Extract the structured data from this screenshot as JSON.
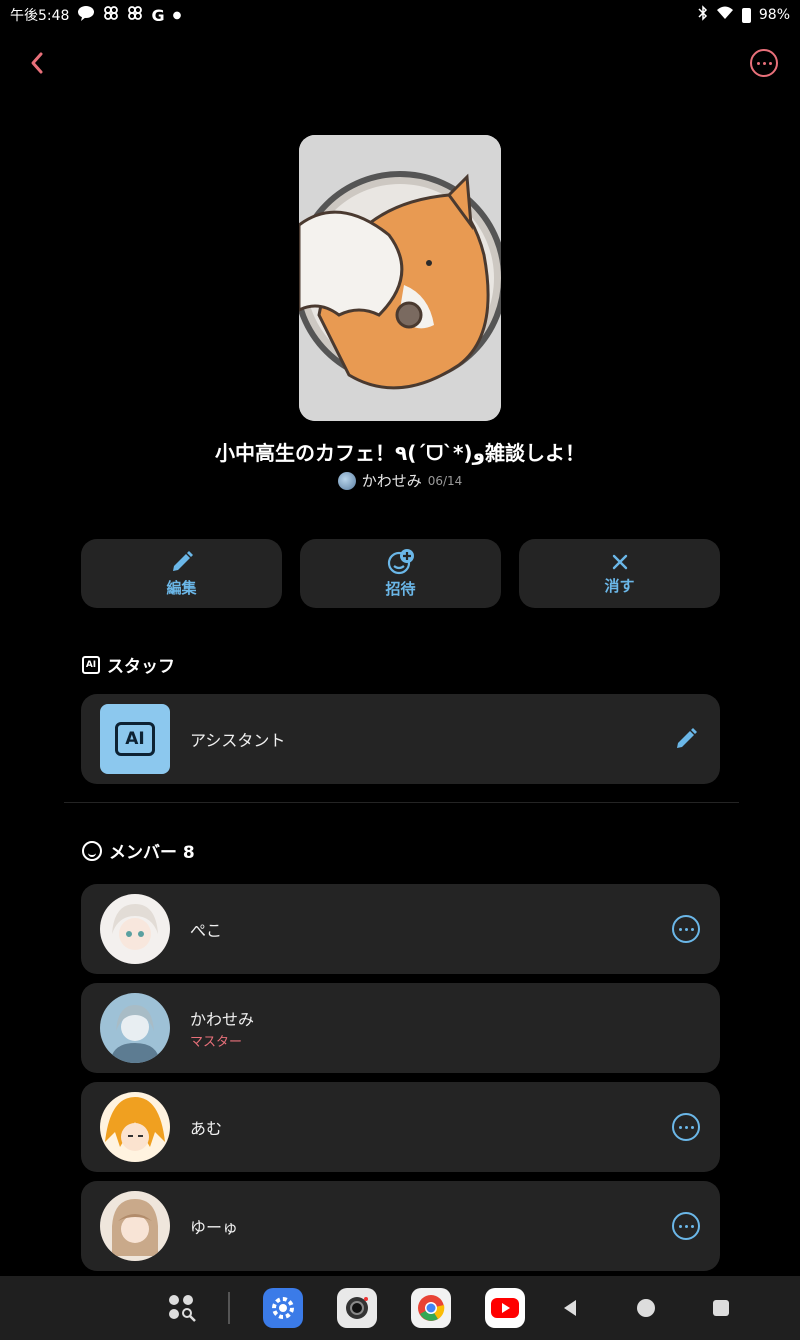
{
  "status_bar": {
    "time": "午後5:48",
    "battery": "98%",
    "left_icons": [
      "line-icon",
      "pinwheel-icon",
      "pinwheel-icon",
      "google-icon",
      "dot-icon"
    ],
    "right_icons": [
      "bluetooth-icon",
      "wifi-icon",
      "battery-icon"
    ]
  },
  "header": {
    "back_icon": "chevron-left-icon",
    "more_icon": "more-circle-icon",
    "accent": "#e8707a"
  },
  "room": {
    "title": "小中高生のカフェ！٩(ˊᗜˋ*)و雑談しよ！",
    "author": "かわせみ",
    "date": "06/14"
  },
  "actions": [
    {
      "label": "編集",
      "icon": "pencil-icon"
    },
    {
      "label": "招待",
      "icon": "add-person-icon"
    },
    {
      "label": "消す",
      "icon": "close-icon"
    }
  ],
  "staff_section": {
    "title": "スタッフ",
    "icon": "ai-icon",
    "items": [
      {
        "name": "アシスタント",
        "icon": "ai-badge-icon",
        "trailing": "pencil-icon"
      }
    ]
  },
  "members_section": {
    "title": "メンバー 8",
    "icon": "smile-icon",
    "items": [
      {
        "name": "ぺこ",
        "role": "",
        "trailing": "more-circle-icon"
      },
      {
        "name": "かわせみ",
        "role": "マスター",
        "trailing": ""
      },
      {
        "name": "あむ",
        "role": "",
        "trailing": "more-circle-icon"
      },
      {
        "name": "ゆーゅ",
        "role": "",
        "trailing": "more-circle-icon"
      }
    ]
  },
  "colors": {
    "accent_blue": "#6bb7e8",
    "accent_pink": "#e8707a",
    "card_bg": "#242424"
  },
  "navbar": {
    "items": [
      "apps-search-icon",
      "settings-app-icon",
      "camera-app-icon",
      "chrome-app-icon",
      "youtube-app-icon",
      "back-triangle-icon",
      "home-circle-icon",
      "recents-square-icon"
    ]
  }
}
